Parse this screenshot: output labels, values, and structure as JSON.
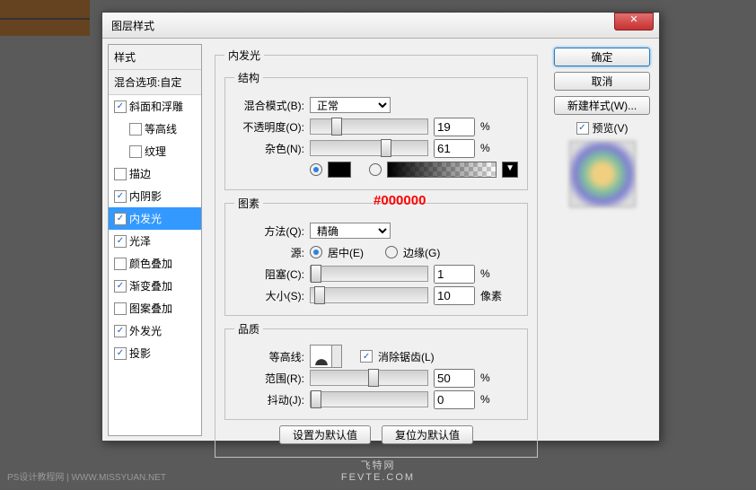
{
  "dialog": {
    "title": "图层样式"
  },
  "sidebar": {
    "heading": "样式",
    "subheading": "混合选项:自定",
    "items": [
      {
        "label": "斜面和浮雕",
        "checked": true,
        "indent": false
      },
      {
        "label": "等高线",
        "checked": false,
        "indent": true
      },
      {
        "label": "纹理",
        "checked": false,
        "indent": true
      },
      {
        "label": "描边",
        "checked": false,
        "indent": false
      },
      {
        "label": "内阴影",
        "checked": true,
        "indent": false
      },
      {
        "label": "内发光",
        "checked": true,
        "indent": false,
        "selected": true
      },
      {
        "label": "光泽",
        "checked": true,
        "indent": false
      },
      {
        "label": "颜色叠加",
        "checked": false,
        "indent": false
      },
      {
        "label": "渐变叠加",
        "checked": true,
        "indent": false
      },
      {
        "label": "图案叠加",
        "checked": false,
        "indent": false
      },
      {
        "label": "外发光",
        "checked": true,
        "indent": false
      },
      {
        "label": "投影",
        "checked": true,
        "indent": false
      }
    ]
  },
  "panel": {
    "title": "内发光"
  },
  "structure": {
    "legend": "结构",
    "blendMode": {
      "label": "混合模式(B):",
      "value": "正常"
    },
    "opacity": {
      "label": "不透明度(O):",
      "value": "19",
      "unit": "%"
    },
    "noise": {
      "label": "杂色(N):",
      "value": "61",
      "unit": "%"
    },
    "annotation": "#000000"
  },
  "elements": {
    "legend": "图素",
    "technique": {
      "label": "方法(Q):",
      "value": "精确"
    },
    "source": {
      "label": "源:",
      "center": "居中(E)",
      "edge": "边缘(G)"
    },
    "choke": {
      "label": "阻塞(C):",
      "value": "1",
      "unit": "%"
    },
    "size": {
      "label": "大小(S):",
      "value": "10",
      "unit": "像素"
    }
  },
  "quality": {
    "legend": "品质",
    "contour": {
      "label": "等高线:"
    },
    "antialias": {
      "label": "消除锯齿(L)",
      "checked": true
    },
    "range": {
      "label": "范围(R):",
      "value": "50",
      "unit": "%"
    },
    "jitter": {
      "label": "抖动(J):",
      "value": "0",
      "unit": "%"
    }
  },
  "bottom": {
    "default": "设置为默认值",
    "reset": "复位为默认值"
  },
  "right": {
    "ok": "确定",
    "cancel": "取消",
    "newStyle": "新建样式(W)...",
    "preview": "预览(V)"
  },
  "footer": {
    "site": "FEVTE.COM",
    "credit": "PS设计教程网 | WWW.MISSYUAN.NET",
    "tag": "飞特网"
  }
}
